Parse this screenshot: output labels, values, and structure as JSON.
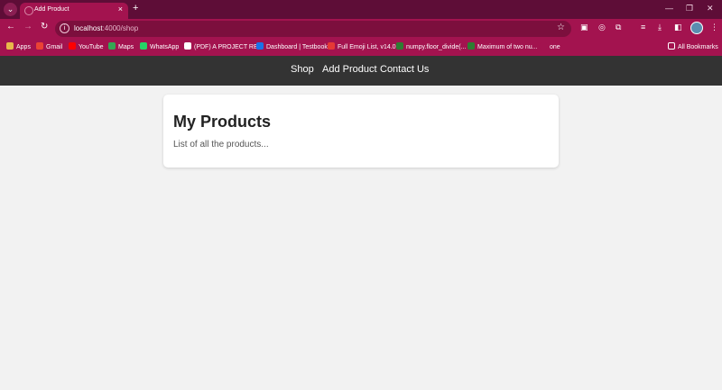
{
  "browser": {
    "tab_title": "Add Product",
    "new_tab_symbol": "+",
    "url_host": "localhost",
    "url_path": ":4000/shop",
    "bookmarks": [
      {
        "label": "Apps",
        "color": "#e8b84a"
      },
      {
        "label": "Gmail",
        "color": "#ea4335"
      },
      {
        "label": "YouTube",
        "color": "#ff0000"
      },
      {
        "label": "Maps",
        "color": "#34a853"
      },
      {
        "label": "WhatsApp",
        "color": "#25d366"
      },
      {
        "label": "(PDF) A PROJECT RE...",
        "color": "#ffffff"
      },
      {
        "label": "Dashboard | Testbook",
        "color": "#1a73e8"
      },
      {
        "label": "Full Emoji List, v14.0",
        "color": "#e53935"
      },
      {
        "label": "numpy.floor_divide(...",
        "color": "#2e7d32"
      },
      {
        "label": "Maximum of two nu...",
        "color": "#2e7d32"
      },
      {
        "label": "one",
        "color": "#a3134f"
      }
    ],
    "all_bookmarks": "All Bookmarks"
  },
  "navbar": {
    "links": [
      "Shop",
      "Add Product",
      "Contact Us"
    ],
    "background": "#333333"
  },
  "main": {
    "title": "My Products",
    "subtitle": "List of all the products..."
  }
}
